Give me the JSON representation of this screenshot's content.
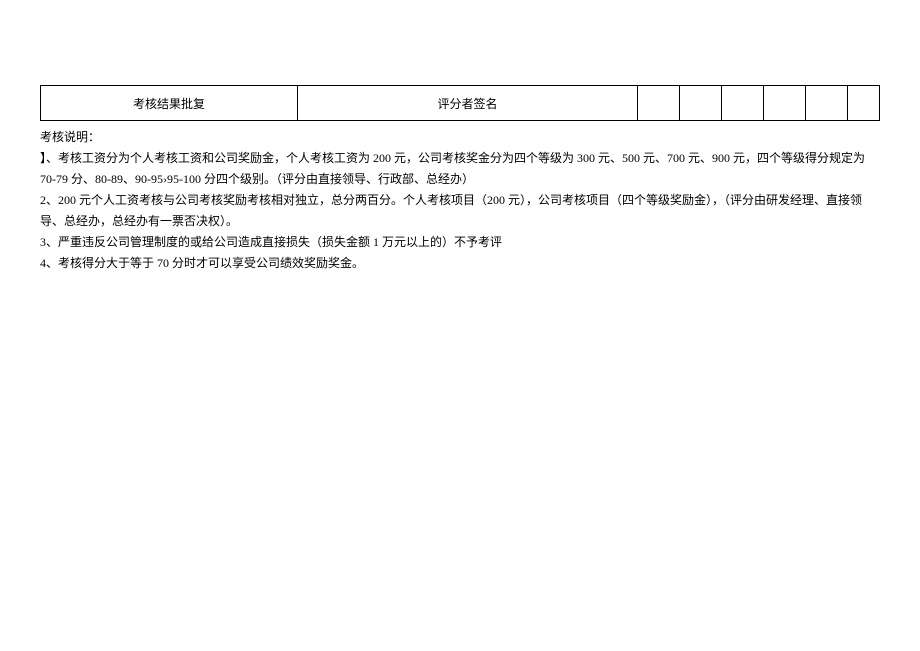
{
  "table": {
    "col1": "考核结果批复",
    "col2": "评分者签名"
  },
  "notes": {
    "title": "考核说明：",
    "line1": "】、考核工资分为个人考核工资和公司奖励金，个人考核工资为 200 元，公司考核奖金分为四个等级为 300 元、500 元、700 元、900 元，四个等级得分规定为 70-79 分、80-89、90-95›95-100 分四个级别。（评分由直接领导、行政部、总经办）",
    "line2": "2、200 元个人工资考核与公司考核奖励考核相对独立，总分两百分。个人考核项目（200 元），公司考核项目（四个等级奖励金），（评分由研发经理、直接领导、总经办，总经办有一票否决权）。",
    "line3": "3、严重违反公司管理制度的或给公司造成直接损失（损失金额 1 万元以上的）不予考评",
    "line4": "4、考核得分大于等于 70 分时才可以享受公司绩效奖励奖金。"
  }
}
